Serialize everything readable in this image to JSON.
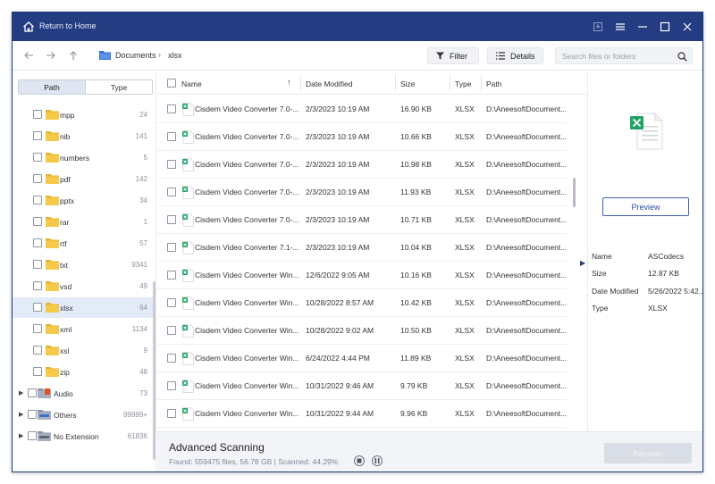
{
  "titlebar": {
    "title": "Return to Home"
  },
  "breadcrumb": {
    "root": "Documents",
    "current": "xlsx"
  },
  "toolbar": {
    "filter_label": "Filter",
    "details_label": "Details"
  },
  "search": {
    "placeholder": "Search files or folders",
    "value": ""
  },
  "sidebar": {
    "tab_path": "Path",
    "tab_type": "Type",
    "items": [
      {
        "name": "mpp",
        "count": "24"
      },
      {
        "name": "nib",
        "count": "141"
      },
      {
        "name": "numbers",
        "count": "5"
      },
      {
        "name": "pdf",
        "count": "142"
      },
      {
        "name": "pptx",
        "count": "34"
      },
      {
        "name": "rar",
        "count": "1"
      },
      {
        "name": "rtf",
        "count": "57"
      },
      {
        "name": "txt",
        "count": "9341"
      },
      {
        "name": "vsd",
        "count": "49"
      },
      {
        "name": "xlsx",
        "count": "64"
      },
      {
        "name": "xml",
        "count": "1134"
      },
      {
        "name": "xsl",
        "count": "9"
      },
      {
        "name": "zip",
        "count": "48"
      }
    ],
    "groups": [
      {
        "name": "Audio",
        "count": "73"
      },
      {
        "name": "Others",
        "count": "99999+"
      },
      {
        "name": "No Extension",
        "count": "61836"
      }
    ]
  },
  "table": {
    "headers": {
      "name": "Name",
      "date": "Date Modified",
      "size": "Size",
      "type": "Type",
      "path": "Path"
    },
    "rows": [
      {
        "name": "Cisdem Video Converter 7.0-...",
        "date": "2/3/2023 10:19 AM",
        "size": "16.90 KB",
        "type": "XLSX",
        "path": "D:\\AneesoftDocument..."
      },
      {
        "name": "Cisdem Video Converter 7.0-...",
        "date": "2/3/2023 10:19 AM",
        "size": "10.66 KB",
        "type": "XLSX",
        "path": "D:\\AneesoftDocument..."
      },
      {
        "name": "Cisdem Video Converter 7.0-...",
        "date": "2/3/2023 10:19 AM",
        "size": "10.98 KB",
        "type": "XLSX",
        "path": "D:\\AneesoftDocument..."
      },
      {
        "name": "Cisdem Video Converter 7.0-...",
        "date": "2/3/2023 10:19 AM",
        "size": "11.93 KB",
        "type": "XLSX",
        "path": "D:\\AneesoftDocument..."
      },
      {
        "name": "Cisdem Video Converter 7.0-...",
        "date": "2/3/2023 10:19 AM",
        "size": "10.71 KB",
        "type": "XLSX",
        "path": "D:\\AneesoftDocument..."
      },
      {
        "name": "Cisdem Video Converter 7.1-...",
        "date": "2/3/2023 10:19 AM",
        "size": "10.04 KB",
        "type": "XLSX",
        "path": "D:\\AneesoftDocument..."
      },
      {
        "name": "Cisdem Video Converter Win...",
        "date": "12/6/2022 9:05 AM",
        "size": "10.16 KB",
        "type": "XLSX",
        "path": "D:\\AneesoftDocument..."
      },
      {
        "name": "Cisdem Video Converter Win...",
        "date": "10/28/2022 8:57 AM",
        "size": "10.42 KB",
        "type": "XLSX",
        "path": "D:\\AneesoftDocument..."
      },
      {
        "name": "Cisdem Video Converter Win...",
        "date": "10/28/2022 9:02 AM",
        "size": "10.50 KB",
        "type": "XLSX",
        "path": "D:\\AneesoftDocument..."
      },
      {
        "name": "Cisdem Video Converter Win...",
        "date": "6/24/2022 4:44 PM",
        "size": "11.89 KB",
        "type": "XLSX",
        "path": "D:\\AneesoftDocument..."
      },
      {
        "name": "Cisdem Video Converter Win...",
        "date": "10/31/2022 9:46 AM",
        "size": "9.79 KB",
        "type": "XLSX",
        "path": "D:\\AneesoftDocument..."
      },
      {
        "name": "Cisdem Video Converter Win...",
        "date": "10/31/2022 9:44 AM",
        "size": "9.96 KB",
        "type": "XLSX",
        "path": "D:\\AneesoftDocument..."
      }
    ]
  },
  "details": {
    "preview_label": "Preview",
    "name_key": "Name",
    "name_value": "ASCodecs",
    "size_key": "Size",
    "size_value": "12.87 KB",
    "date_key": "Date Modified",
    "date_value": "5/26/2022 5:42...",
    "type_key": "Type",
    "type_value": "XLSX"
  },
  "status": {
    "title": "Advanced Scanning",
    "stats": "Found: 559475 files, 56.78 GB  |  Scanned: 44.29%",
    "scanned_fraction": 0.4429,
    "recover_label": "Recover"
  },
  "colors": {
    "titlebar": "#243d82",
    "accent": "#3a62c4",
    "folder": "#f2c744",
    "excel": "#21a366"
  }
}
